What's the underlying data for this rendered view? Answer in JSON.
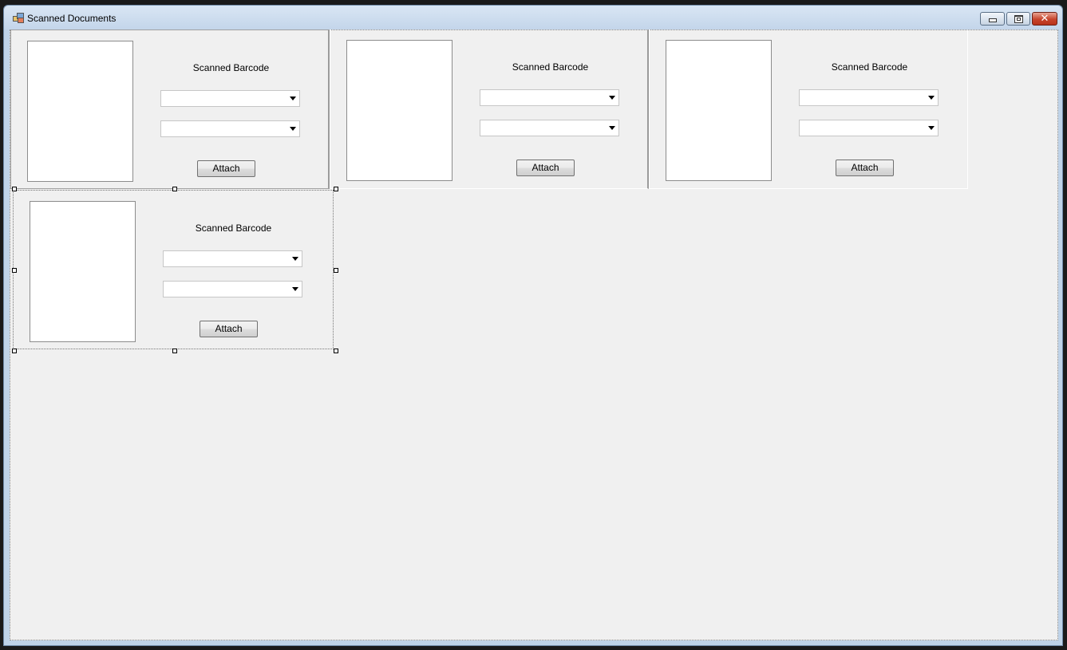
{
  "window": {
    "title": "Scanned Documents",
    "close_glyph": "✕"
  },
  "panels": [
    {
      "barcode_label": "Scanned Barcode",
      "combo1_value": "",
      "combo2_value": "",
      "attach_label": "Attach"
    },
    {
      "barcode_label": "Scanned Barcode",
      "combo1_value": "",
      "combo2_value": "",
      "attach_label": "Attach"
    },
    {
      "barcode_label": "Scanned Barcode",
      "combo1_value": "",
      "combo2_value": "",
      "attach_label": "Attach"
    },
    {
      "barcode_label": "Scanned Barcode",
      "combo1_value": "",
      "combo2_value": "",
      "attach_label": "Attach"
    }
  ],
  "icons": {
    "app": "form-icon",
    "minimize": "minimize-icon",
    "maximize": "restore-icon",
    "close": "close-icon",
    "dropdown": "chevron-down-icon"
  }
}
